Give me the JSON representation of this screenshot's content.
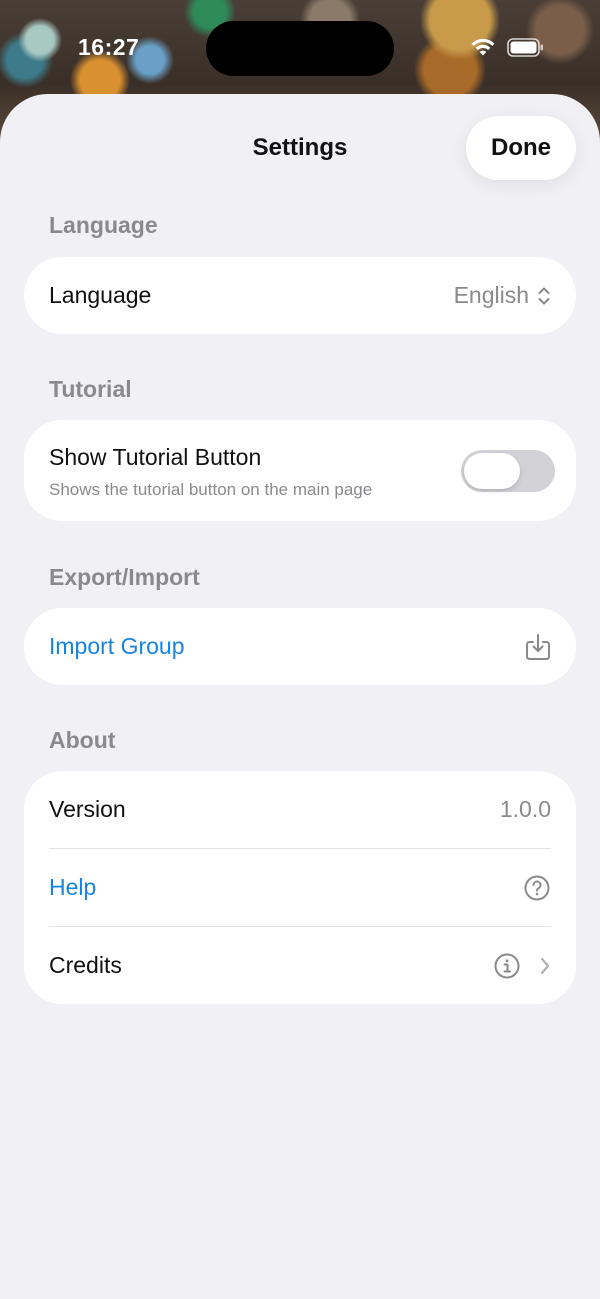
{
  "status_bar": {
    "time": "16:27"
  },
  "nav": {
    "title": "Settings",
    "done_label": "Done"
  },
  "sections": {
    "language": {
      "header": "Language",
      "row_label": "Language",
      "row_value": "English"
    },
    "tutorial": {
      "header": "Tutorial",
      "row_label": "Show Tutorial Button",
      "row_subtitle": "Shows the tutorial button on the main page",
      "toggle_on": false
    },
    "export_import": {
      "header": "Export/Import",
      "row_label": "Import Group"
    },
    "about": {
      "header": "About",
      "version_label": "Version",
      "version_value": "1.0.0",
      "help_label": "Help",
      "credits_label": "Credits"
    }
  },
  "icons": {
    "updown": "chevron-up-down-icon",
    "import": "import-tray-icon",
    "help": "question-circle-icon",
    "info": "info-circle-icon",
    "chevron": "chevron-right-icon"
  },
  "colors": {
    "accent": "#1684e3",
    "background": "#f0f0f5",
    "card": "#ffffff",
    "secondary_text": "#8a8a8e",
    "toggle_off": "#d1d1d6"
  }
}
